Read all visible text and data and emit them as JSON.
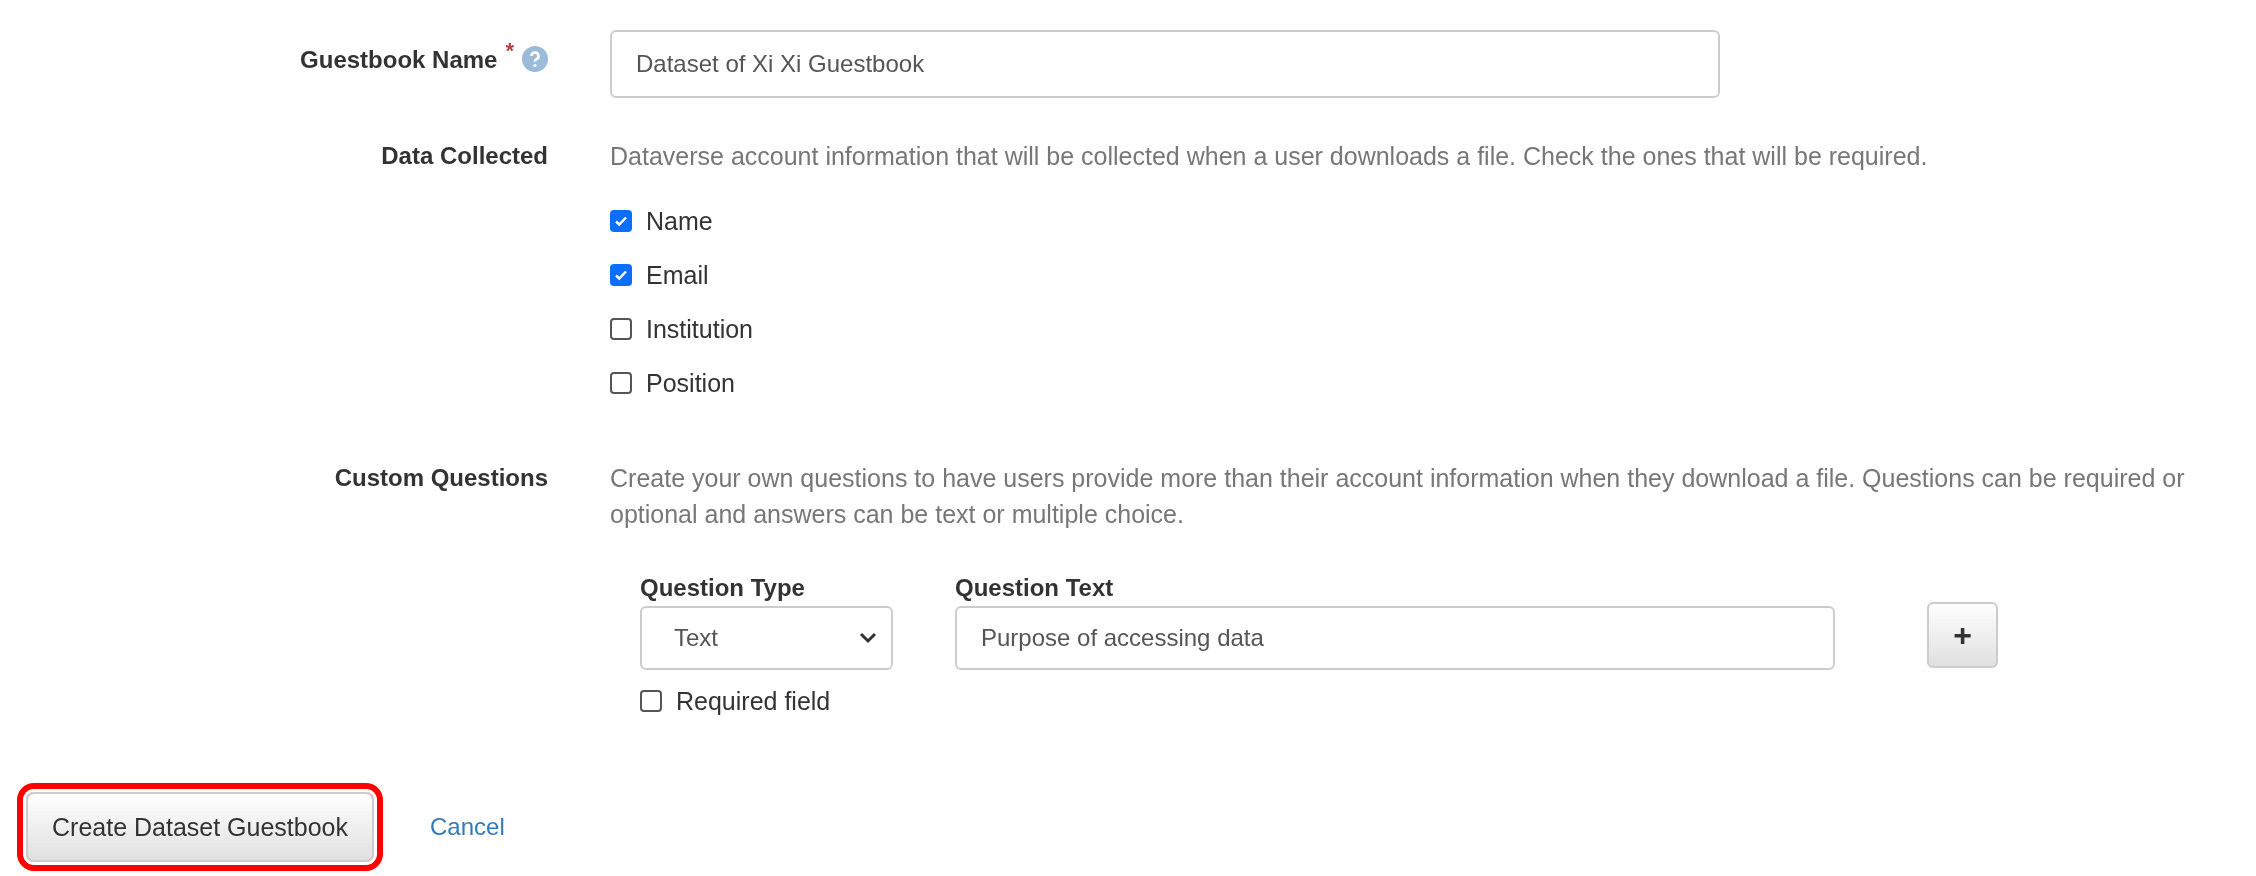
{
  "guestbook_name": {
    "label": "Guestbook Name",
    "required_mark": "*",
    "value": "Dataset of Xi Xi Guestbook"
  },
  "data_collected": {
    "label": "Data Collected",
    "description": "Dataverse account information that will be collected when a user downloads a file. Check the ones that will be required.",
    "options": [
      {
        "label": "Name",
        "checked": true
      },
      {
        "label": "Email",
        "checked": true
      },
      {
        "label": "Institution",
        "checked": false
      },
      {
        "label": "Position",
        "checked": false
      }
    ]
  },
  "custom_questions": {
    "label": "Custom Questions",
    "description": "Create your own questions to have users provide more than their account information when they download a file. Questions can be required or optional and answers can be text or multiple choice.",
    "question_type_label": "Question Type",
    "question_type": "Text",
    "question_text_label": "Question Text",
    "question_text": "Purpose of accessing data",
    "add_button": "+",
    "required": {
      "label": "Required field",
      "checked": false
    }
  },
  "actions": {
    "create": {
      "label": "Create Dataset Guestbook",
      "highlighted": true
    },
    "cancel": "Cancel"
  }
}
